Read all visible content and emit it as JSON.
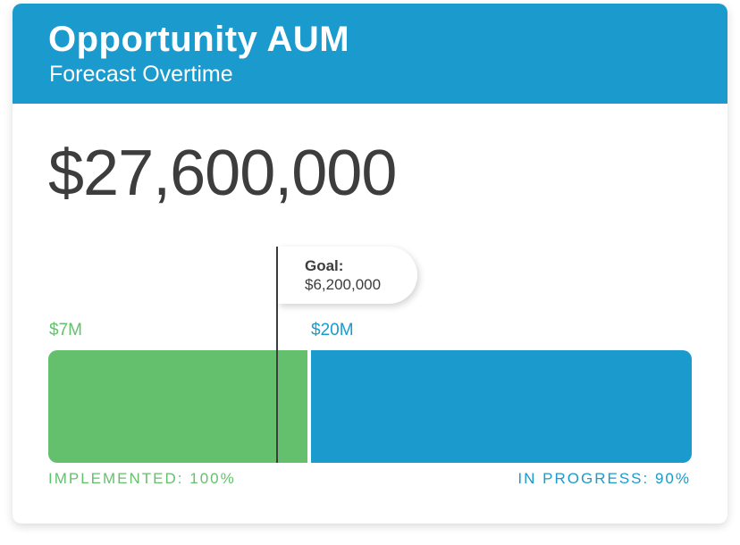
{
  "header": {
    "title": "Opportunity AUM",
    "subtitle": "Forecast Overtime"
  },
  "total_value": "$27,600,000",
  "goal": {
    "label": "Goal:",
    "value": "$6,200,000"
  },
  "segments": [
    {
      "amount_label": "$7M",
      "status_label": "IMPLEMENTED:",
      "status_percent": "100%",
      "color": "#65c06e"
    },
    {
      "amount_label": "$20M",
      "status_label": "IN PROGRESS:",
      "status_percent": "90%",
      "color": "#1a9acd"
    }
  ],
  "colors": {
    "header_bg": "#1a9acd",
    "text_dark": "#3d3d3d"
  }
}
